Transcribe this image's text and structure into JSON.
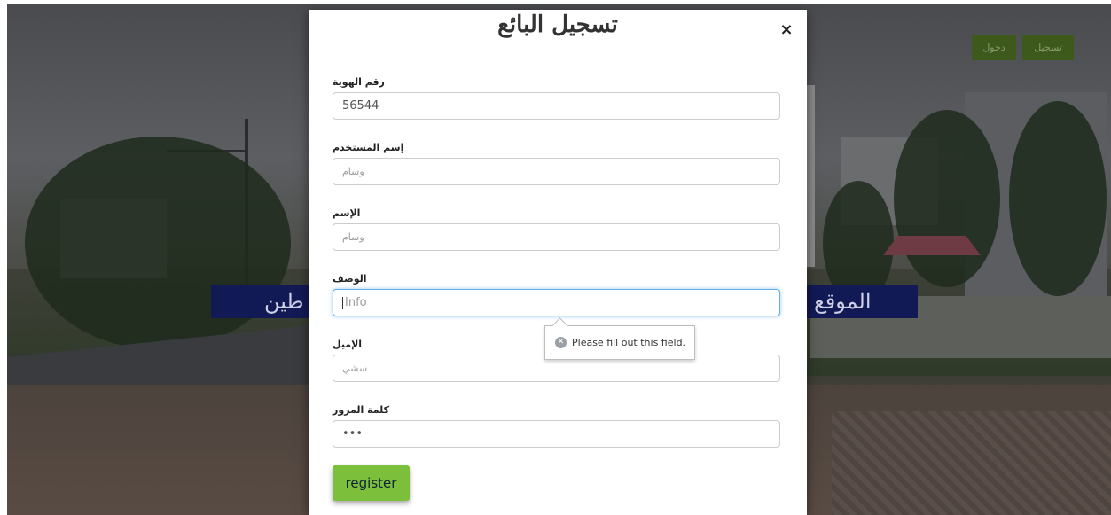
{
  "header": {
    "register_label": "تسجيل",
    "login_label": "دخول"
  },
  "banner": {
    "left_text": "طين",
    "right_text": "الموقع"
  },
  "modal": {
    "title": "تسجيل البائع",
    "close_glyph": "×",
    "fields": [
      {
        "label": "رقم الهوية",
        "value": "56544",
        "placeholder": ""
      },
      {
        "label": "إسم المستخدم",
        "value": "",
        "placeholder": "وسام"
      },
      {
        "label": "الإسم",
        "value": "",
        "placeholder": "وسام"
      },
      {
        "label": "الوصف",
        "value": "",
        "placeholder": "Info"
      },
      {
        "label": "الإميل",
        "value": "",
        "placeholder": "سشي"
      },
      {
        "label": "كلمة المرور",
        "value": "•••",
        "placeholder": ""
      }
    ],
    "submit_label": "register"
  },
  "tooltip": {
    "message": "Please fill out this field."
  },
  "colors": {
    "accent": "#7cbf3b",
    "header_button": "#3d5a1c",
    "banner": "#121a56",
    "focus": "#66afe9"
  }
}
